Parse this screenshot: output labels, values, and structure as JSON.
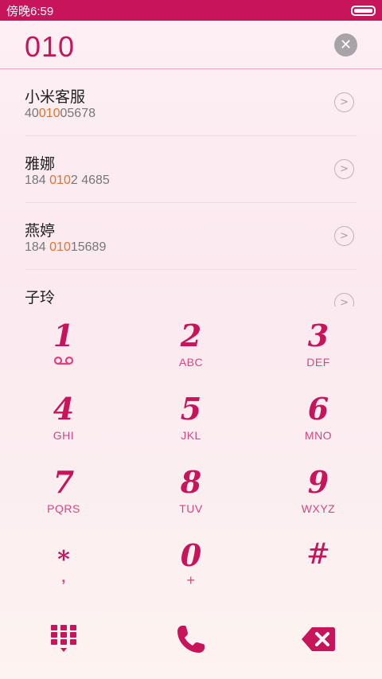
{
  "status_bar": {
    "time": "傍晚6:59"
  },
  "dialer": {
    "number": "010"
  },
  "results": [
    {
      "name": "小米客服",
      "number_pre": "40",
      "number_hl": "010",
      "number_post": "05678"
    },
    {
      "name": "雅娜",
      "number_pre": "184 ",
      "number_hl": "010",
      "number_post": "2 4685"
    },
    {
      "name": "燕婷",
      "number_pre": "184 ",
      "number_hl": "010",
      "number_post": "15689"
    },
    {
      "name": "子玲",
      "number_pre": "",
      "number_hl": "",
      "number_post": ""
    }
  ],
  "keypad": [
    {
      "digit": "1",
      "letters": ""
    },
    {
      "digit": "2",
      "letters": "ABC"
    },
    {
      "digit": "3",
      "letters": "DEF"
    },
    {
      "digit": "4",
      "letters": "GHI"
    },
    {
      "digit": "5",
      "letters": "JKL"
    },
    {
      "digit": "6",
      "letters": "MNO"
    },
    {
      "digit": "7",
      "letters": "PQRS"
    },
    {
      "digit": "8",
      "letters": "TUV"
    },
    {
      "digit": "9",
      "letters": "WXYZ"
    },
    {
      "digit": "*",
      "letters": ","
    },
    {
      "digit": "0",
      "letters": "+"
    },
    {
      "digit": "#",
      "letters": ""
    }
  ],
  "colors": {
    "accent": "#c8145a",
    "highlight": "#e8702a"
  },
  "icons": [
    "voicemail-icon",
    "keypad-grid-icon",
    "phone-call-icon",
    "backspace-icon",
    "clear-icon",
    "chevron-right-icon"
  ]
}
